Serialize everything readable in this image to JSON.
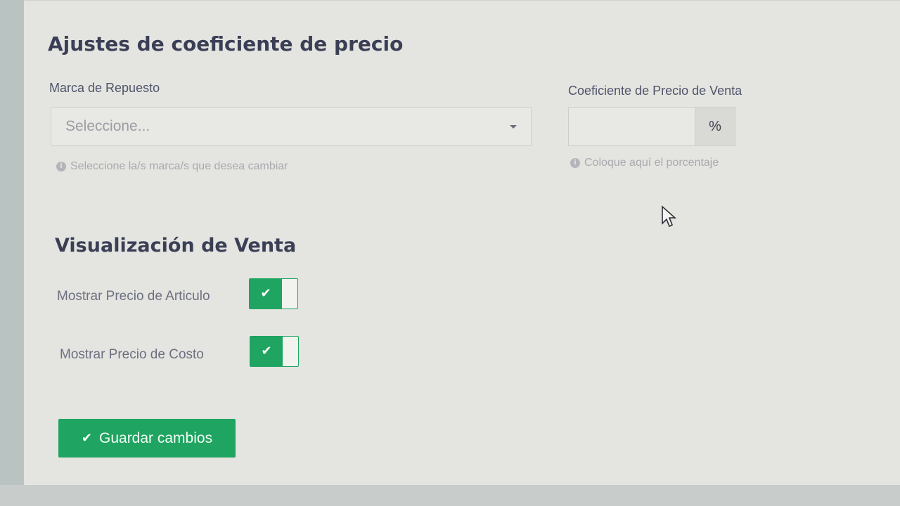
{
  "pricing": {
    "title": "Ajustes de coeficiente de precio",
    "brand": {
      "label": "Marca de Repuesto",
      "placeholder": "Seleccione...",
      "help": "Seleccione la/s marca/s que desea cambiar"
    },
    "coefficient": {
      "label": "Coeficiente de Precio de Venta",
      "value": "",
      "addon": "%",
      "help": "Coloque aquí el porcentaje"
    }
  },
  "visualization": {
    "title": "Visualización de Venta",
    "toggles": [
      {
        "label": "Mostrar Precio de Articulo",
        "state": "on"
      },
      {
        "label": "Mostrar Precio de Costo",
        "state": "on"
      }
    ]
  },
  "actions": {
    "save_label": "Guardar cambios"
  },
  "icons": {
    "check": "check-icon",
    "info": "info-icon",
    "caret": "chevron-down-icon"
  },
  "colors": {
    "accent": "#1fa461",
    "heading": "#3a3f56",
    "background": "#e4e4e0"
  }
}
